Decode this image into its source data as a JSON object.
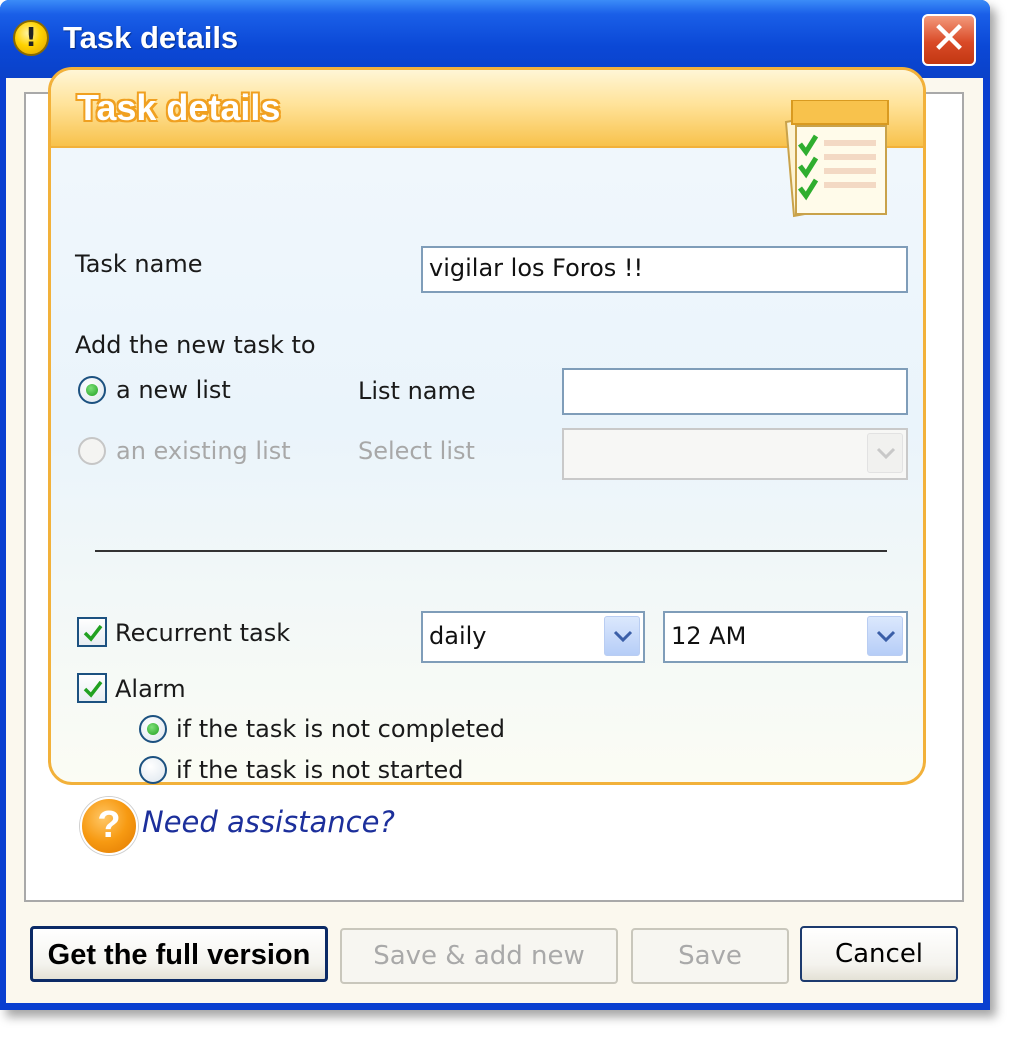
{
  "window": {
    "title": "Task details",
    "title_icon": "warning-icon",
    "close_icon": "close-icon"
  },
  "panel": {
    "header_title": "Task details",
    "header_icon": "checklist-icon"
  },
  "form": {
    "task_name_label": "Task name",
    "task_name_value": "vigilar los Foros !!",
    "add_to_label": "Add the new task to",
    "new_list_label": "a new list",
    "new_list_checked": true,
    "existing_list_label": "an existing list",
    "existing_list_checked": false,
    "list_name_label": "List name",
    "list_name_value": "",
    "select_list_label": "Select list",
    "select_list_value": "",
    "recurrent_label": "Recurrent task",
    "recurrent_checked": true,
    "frequency_value": "daily",
    "time_value": "12 AM",
    "alarm_label": "Alarm",
    "alarm_checked": true,
    "not_completed_label": "if the task is not completed",
    "not_completed_checked": true,
    "not_started_label": "if the task is not started",
    "not_started_checked": false
  },
  "help": {
    "icon": "help-icon",
    "link": "Need assistance?"
  },
  "buttons": {
    "full_version": "Get the full version",
    "save_add_new": "Save & add new",
    "save": "Save",
    "cancel": "Cancel"
  },
  "colors": {
    "titlebar": "#0a41c9",
    "panel_border": "#f2b13a",
    "link": "#1c2f9b",
    "checkmark": "#21a121"
  }
}
